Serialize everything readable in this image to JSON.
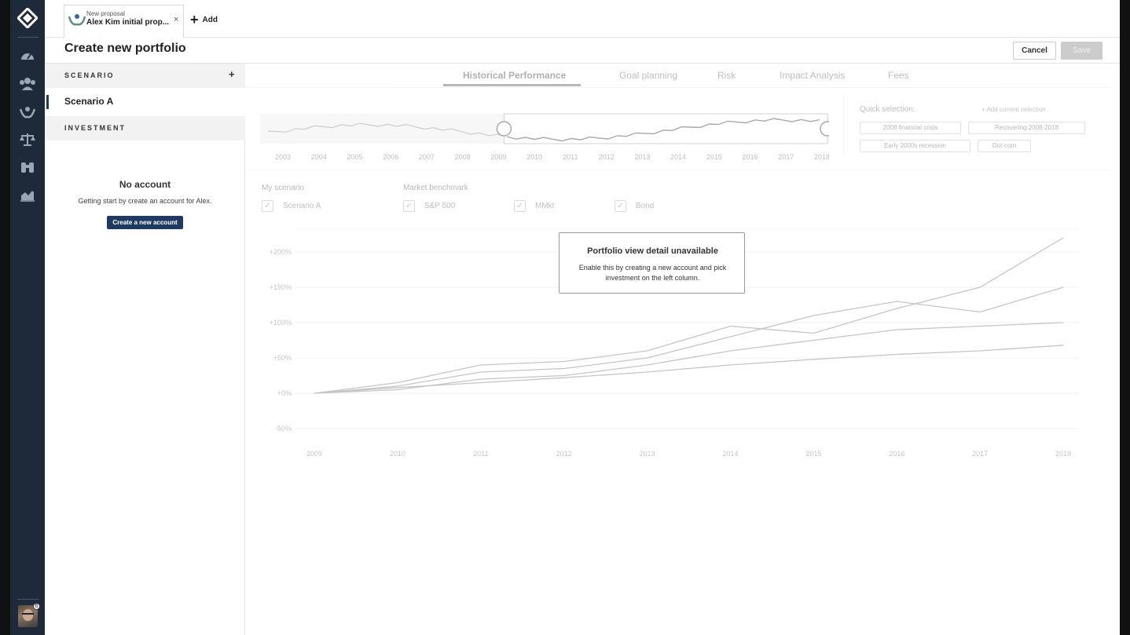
{
  "proposal_tab": {
    "small_label": "New proposal",
    "title": "Alex Kim initial prop...",
    "close_glyph": "×"
  },
  "add_tab": {
    "label": "Add"
  },
  "header": {
    "title": "Create new portfolio",
    "cancel_label": "Cancel",
    "save_label": "Save"
  },
  "nav": {
    "icons": [
      "dashboard-icon",
      "clients-icon",
      "proposals-icon",
      "balance-icon",
      "binoculars-icon",
      "chart-icon"
    ],
    "avatar_badge": "6"
  },
  "left_panel": {
    "scenario_header": "SCENARIO",
    "scenario_add": "+",
    "scenario_item": "Scenario A",
    "investment_header": "INVESTMENT",
    "no_account_title": "No account",
    "no_account_message": "Getting start by create an account for Alex.",
    "create_account_label": "Create a new account"
  },
  "tabs": [
    "Historical Performance",
    "Goal planning",
    "Risk",
    "Impact Analysis",
    "Fees"
  ],
  "active_tab": "Historical Performance",
  "timeline": {
    "years": [
      "2003",
      "2004",
      "2005",
      "2006",
      "2007",
      "2008",
      "2009",
      "2010",
      "2011",
      "2012",
      "2013",
      "2014",
      "2015",
      "2016",
      "2017",
      "2018"
    ],
    "range": [
      "2009",
      "2018"
    ]
  },
  "quick_selection": {
    "title": "Quick selection:",
    "add_label": "+ Add current selection",
    "chips": [
      "2008 financial crisis",
      "Recovering 2008-2018",
      "Early 2000s recession",
      "Dot-com"
    ]
  },
  "legend": {
    "my_scenario_label": "My scenario",
    "market_benchmark_label": "Market benchmark",
    "items": [
      "Scenario A",
      "S&P 500",
      "MMkt",
      "Bond"
    ],
    "check_glyph": "✓"
  },
  "modal": {
    "title": "Portfolio view detail unavailable",
    "body": "Enable this by creating a new account and pick investment on the left column."
  },
  "colors": {
    "nav_bg": "#1e2a3a",
    "primary": "#1e3a63",
    "disabled": "#cccccc"
  },
  "chart_data": {
    "type": "line",
    "x": [
      "2009",
      "2010",
      "2011",
      "2012",
      "2013",
      "2014",
      "2015",
      "2016",
      "2017",
      "2018"
    ],
    "y_tick_labels": [
      "+200%",
      "+150%",
      "+100%",
      "+50%",
      "+0%",
      "-50%"
    ],
    "ylim": [
      -50,
      200
    ],
    "grid": true,
    "series": [
      {
        "values": [
          0,
          15,
          40,
          45,
          60,
          95,
          85,
          120,
          150,
          220
        ]
      },
      {
        "values": [
          0,
          10,
          30,
          35,
          50,
          80,
          110,
          130,
          115,
          150
        ]
      },
      {
        "values": [
          0,
          5,
          20,
          25,
          40,
          60,
          75,
          90,
          95,
          100
        ]
      },
      {
        "values": [
          0,
          8,
          15,
          22,
          30,
          40,
          48,
          55,
          60,
          68
        ]
      }
    ]
  }
}
